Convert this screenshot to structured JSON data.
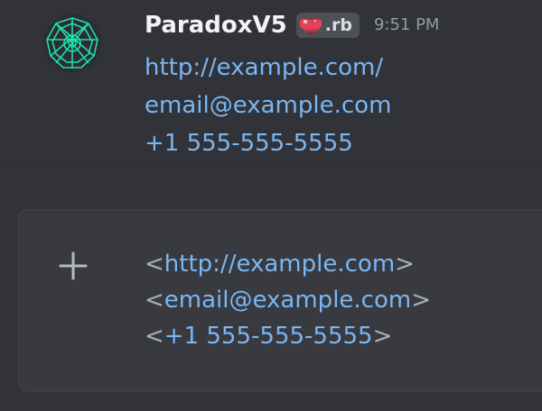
{
  "message": {
    "username": "ParadoxV5",
    "tag_text": ".rb",
    "tag_icon": "pixel-heart-icon",
    "timestamp": "9:51 PM",
    "lines": [
      "http://example.com/",
      "email@example.com",
      "+1 555-555-5555"
    ]
  },
  "composer": {
    "add_icon": "plus-icon",
    "lines": [
      {
        "open": "<",
        "text": "http://example.com",
        "close": ">"
      },
      {
        "open": "<",
        "text": "email@example.com",
        "close": ">"
      },
      {
        "open": "<",
        "text": "+1 555-555-5555",
        "close": ">"
      }
    ]
  },
  "colors": {
    "background": "#313338",
    "composer": "#383a40",
    "link": "#7ab6f2",
    "avatar_accent": "#1de0b0"
  }
}
